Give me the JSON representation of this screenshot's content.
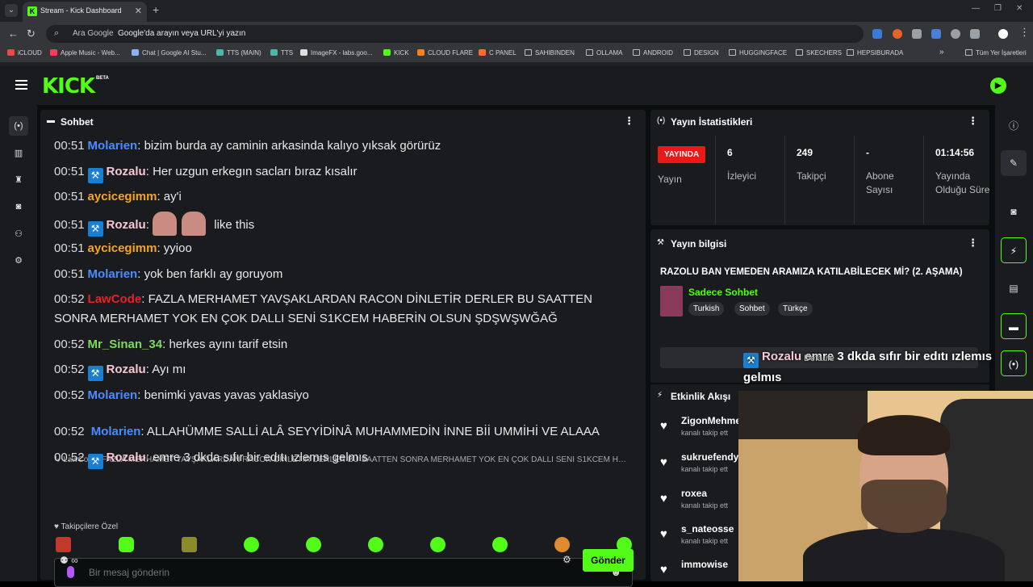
{
  "browser": {
    "tab_title": "Stream - Kick Dashboard",
    "omnibox_engine": "Ara Google",
    "omnibox_placeholder": "Google'da arayın veya URL'yi yazın",
    "bookmarks": [
      "iCLOUD",
      "Apple Music - Web...",
      "Chat | Google AI Stu...",
      "TTS (MAIN)",
      "TTS",
      "ImageFX - labs.goo...",
      "KICK",
      "CLOUD FLARE",
      "C PANEL",
      "SAHIBINDEN",
      "OLLAMA",
      "ANDROID",
      "DESIGN",
      "HUGGINGFACE",
      "SKECHERS",
      "HEPSIBURADA"
    ],
    "all_bookmarks": "Tüm Yer İşaretleri"
  },
  "site": {
    "logo": "KICK",
    "logo_beta": "BETA",
    "accent": "#53fc18"
  },
  "chat": {
    "title": "Sohbet",
    "messages": [
      {
        "time": "00:51",
        "user": "Molarien",
        "color": "#4a8cff",
        "badge": false,
        "text": "bizim burda ay caminin arkasinda kalıyo yıksak görürüz"
      },
      {
        "time": "00:51",
        "user": "Rozalu",
        "color": "#f7c8d4",
        "badge": true,
        "text": "Her uzgun erkegın sacları bıraz kısalır"
      },
      {
        "time": "00:51",
        "user": "aycicegimm",
        "color": "#f5a623",
        "badge": false,
        "text": "ay'i"
      },
      {
        "time": "00:51",
        "user": "Rozalu",
        "color": "#f7c8d4",
        "badge": true,
        "text": "like this"
      },
      {
        "time": "00:51",
        "user": "aycicegimm",
        "color": "#f5a623",
        "badge": false,
        "text": "yyioo"
      },
      {
        "time": "00:51",
        "user": "Molarien",
        "color": "#4a8cff",
        "badge": false,
        "text": "yok ben farklı ay goruyom"
      },
      {
        "time": "00:52",
        "user": "LawCode",
        "color": "#e8202a",
        "badge": false,
        "text": "FAZLA MERHAMET YAVŞAKLARDAN RACON DİNLETİR DERLER BU SAATTEN",
        "text2": "SONRA MERHAMET YOK EN ÇOK DALLI SENİ S1KCEM HABERİN OLSUN ŞDŞWŞWĞAĞ"
      },
      {
        "time": "00:52",
        "user": "Mr_Sinan_34",
        "color": "#7ed957",
        "badge": false,
        "text": "herkes ayını tarif etsin"
      },
      {
        "time": "00:52",
        "user": "Rozalu",
        "color": "#f7c8d4",
        "badge": true,
        "text": "Ayı mı"
      },
      {
        "time": "00:52",
        "user": "Molarien",
        "color": "#4a8cff",
        "badge": false,
        "text": "benimki yavas yavas yaklasiyo"
      },
      {
        "time": "00:52",
        "user": "Molarien",
        "color": "#4a8cff",
        "badge": false,
        "text": "ALLAHÜMME SALLİ ALÂ SEYYİDİNÂ MUHAMMEDİN İNNE Bİİ UMMİHİ VE ALAAA"
      },
      {
        "time": "00:52",
        "user": "Rozalu",
        "color": "#f7c8d4",
        "badge": true,
        "text": "emre 3 dkda sıfır bir edıtı ızlemıs gelmıs"
      }
    ],
    "reply_preview": "↳ LawCode: FAZLA MERHAMET YAVŞAKLARDAN RACON DİNLETİR DERLER BU SAATTEN SONRA MERHAMET YOK EN ÇOK DALLI SENİ S1KCEM HABERİN OLSUN ŞDŞWŞWĞAĞ",
    "followers_only": "♥ Takipçilere Özel",
    "input_placeholder": "Bir mesaj gönderin",
    "points": "∞",
    "send_label": "Gönder"
  },
  "stats": {
    "title": "Yayın İstatistikleri",
    "live_badge": "YAYINDA",
    "live_label": "Yayın",
    "items": [
      {
        "value": "6",
        "label": "İzleyici"
      },
      {
        "value": "249",
        "label": "Takipçi"
      },
      {
        "value": "-",
        "label": "Abone Sayısı"
      },
      {
        "value": "01:14:56",
        "label": "Yayında Olduğu Süre"
      }
    ]
  },
  "info": {
    "title": "Yayın bilgisi",
    "stream_title": "RAZOLU BAN YEMEDEN ARAMIZA KATILABİLECEK Mİ? (2. AŞAMA)",
    "category": "Sadece Sohbet",
    "tags": [
      "Turkish",
      "Sohbet",
      "Türkçe"
    ]
  },
  "overlay": {
    "user": "Rozalu",
    "under_text": "Defaule",
    "text": "emre 3 dkda sıfır bir edıtı ızlemıs gelmıs"
  },
  "events": {
    "title": "Etkinlik Akışı",
    "items": [
      {
        "name": "ZigonMehme",
        "sub": "kanalı takip ett"
      },
      {
        "name": "sukruefendy",
        "sub": "kanalı takip ett"
      },
      {
        "name": "roxea",
        "sub": "kanalı takip ett"
      },
      {
        "name": "s_nateosse",
        "sub": "kanalı takip ett"
      },
      {
        "name": "immowise",
        "sub": ""
      }
    ]
  }
}
